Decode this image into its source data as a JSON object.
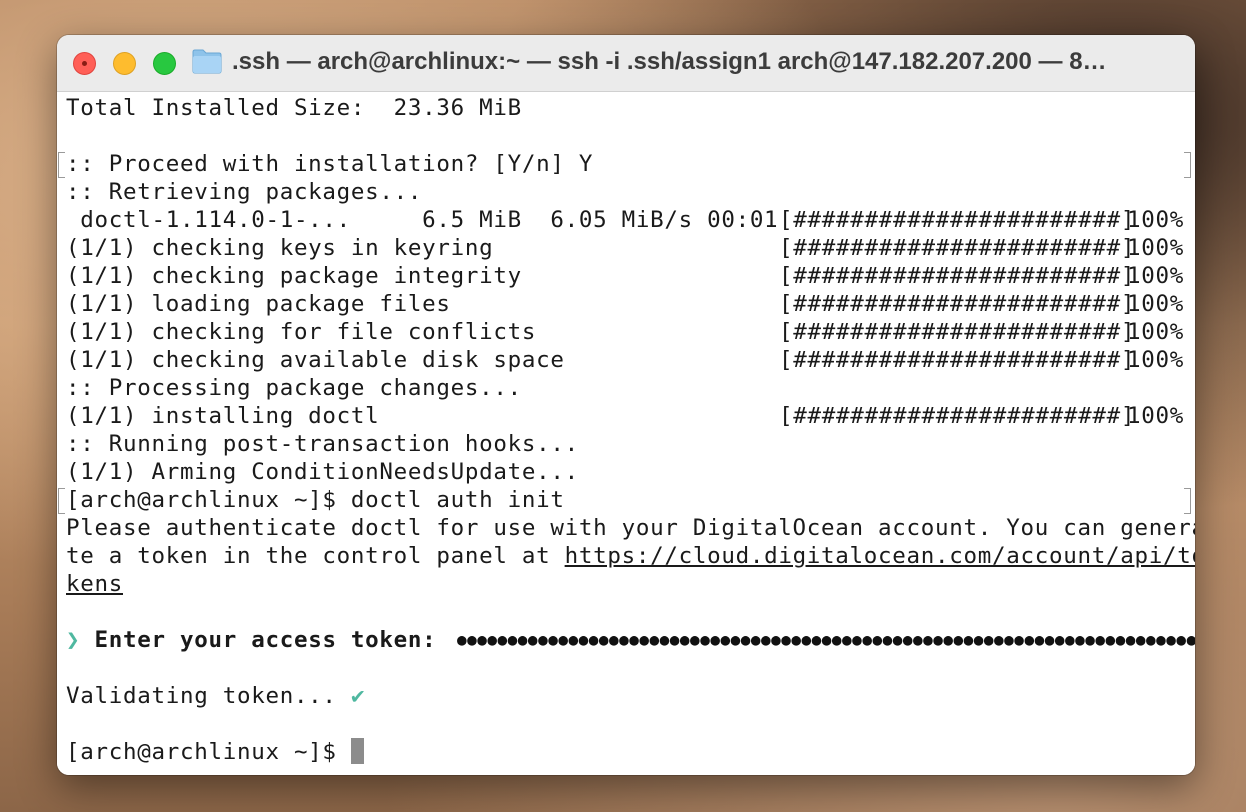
{
  "window": {
    "title": ".ssh — arch@archlinux:~ — ssh -i .ssh/assign1 arch@147.182.207.200 — 8…"
  },
  "icons": {
    "close": "close-icon",
    "minimize": "minimize-icon",
    "maximize": "maximize-icon",
    "folder": "folder-icon"
  },
  "colors": {
    "prompt_accent": "#4fb8a0",
    "cursor": "#8c8c8c"
  },
  "terminal": {
    "total_size": "Total Installed Size:  23.36 MiB",
    "proceed": ":: Proceed with installation? [Y/n] Y",
    "retrieving": ":: Retrieving packages...",
    "download_line": " doctl-1.114.0-1-...     6.5 MiB  6.05 MiB/s 00:01",
    "progress_bar": "[#######################]",
    "progress_pct": "100%",
    "steps": [
      "(1/1) checking keys in keyring",
      "(1/1) checking package integrity",
      "(1/1) loading package files",
      "(1/1) checking for file conflicts",
      "(1/1) checking available disk space"
    ],
    "processing": ":: Processing package changes...",
    "installing": "(1/1) installing doctl",
    "hooks": ":: Running post-transaction hooks...",
    "arming": "(1/1) Arming ConditionNeedsUpdate...",
    "command": "[arch@archlinux ~]$ doctl auth init",
    "auth_msg_1": "Please authenticate doctl for use with your DigitalOcean account. You can genera",
    "auth_msg_2_prefix": "te a token in the control panel at ",
    "auth_link_part1": "https://cloud.digitalocean.com/account/api/to",
    "auth_link_part2": "kens",
    "token_chevron": "❯",
    "token_label": "Enter your access token:",
    "token_mask": "●●●●●●●●●●●●●●●●●●●●●●●●●●●●●●●●●●●●●●●●●●●●●●●●●●●●●●●●●●●●●●●●●●●●●●●●●●●●",
    "validating": "Validating token... ",
    "check_mark": "✔",
    "final_prompt": "[arch@archlinux ~]$ "
  }
}
